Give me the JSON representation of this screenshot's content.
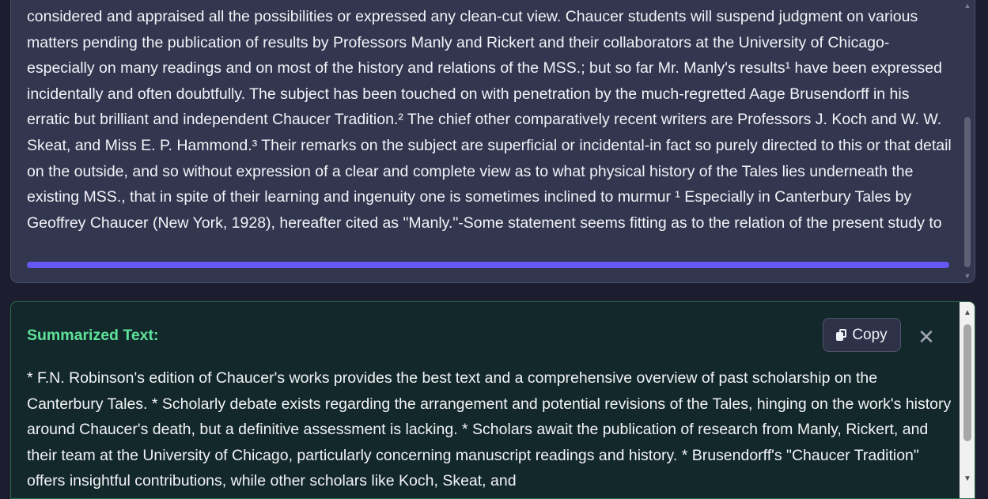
{
  "source": {
    "text": "considered and appraised all the possibilities or expressed any clean-cut view. Chaucer students will suspend judgment on various matters pending the publication of results by Professors Manly and Rickert and their collaborators at the University of Chicago-especially on many readings and on most of the history and relations of the MSS.; but so far Mr. Manly's results¹ have been expressed incidentally and often doubtfully. The subject has been touched on with penetration by the much-regretted Aage Brusendorff in his erratic but brilliant and independent Chaucer Tradition.² The chief other comparatively recent writers are Professors J. Koch and W. W. Skeat, and Miss E. P. Hammond.³ Their remarks on the subject are superficial or incidental-in fact so purely directed to this or that detail on the outside, and so without expression of a clear and complete view as to what physical history of the Tales lies underneath the existing MSS., that in spite of their learning and ingenuity one is sometimes inclined to murmur ¹ Especially in Canterbury Tales by Geoffrey Chaucer (New York, 1928), hereafter cited as \"Manly.\"-Some statement seems fitting as to the relation of the present study to"
  },
  "summary": {
    "title": "Summarized Text:",
    "copy_label": "Copy",
    "close_icon": "close-icon",
    "text": "* F.N. Robinson's edition of Chaucer's works provides the best text and a comprehensive overview of past scholarship on the Canterbury Tales. * Scholarly debate exists regarding the arrangement and potential revisions of the Tales, hinging on the work's history around Chaucer's death, but a definitive assessment is lacking. * Scholars await the publication of research from Manly, Rickert, and their team at the University of Chicago, particularly concerning manuscript readings and history. * Brusendorff's \"Chaucer Tradition\" offers insightful contributions, while other scholars like Koch, Skeat, and"
  },
  "colors": {
    "page_background": "#1c1e30",
    "source_panel": "#33364f",
    "summary_panel": "#13282a",
    "summary_title": "#5ee39a",
    "highlight": "#6558f5"
  }
}
